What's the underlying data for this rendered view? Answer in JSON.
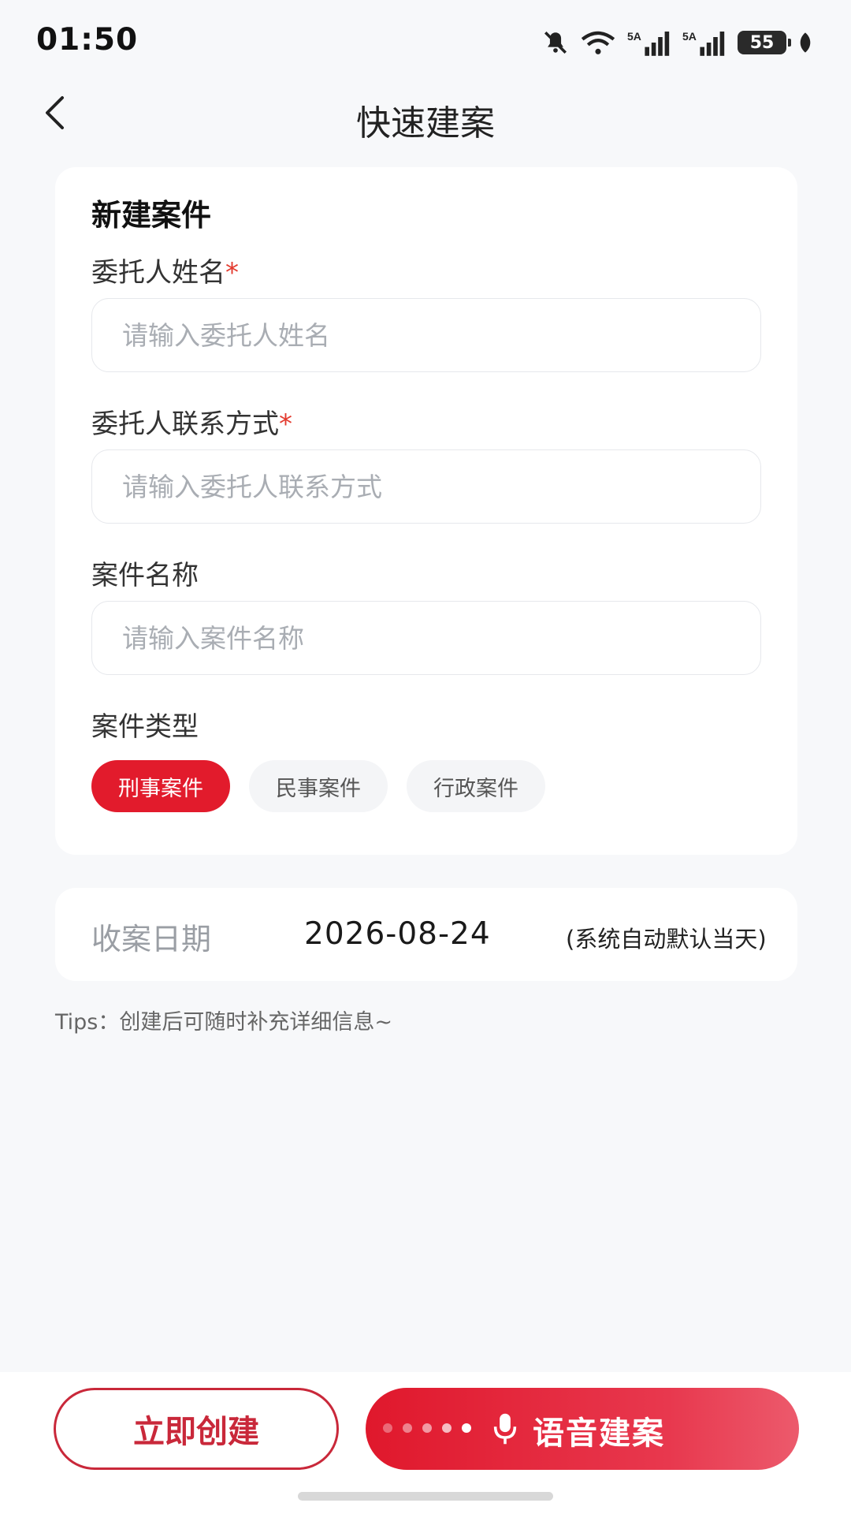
{
  "status_bar": {
    "time": "01:50",
    "battery": "55",
    "icons": [
      "bell-muted-icon",
      "wifi-icon",
      "signal-5a-icon",
      "signal-5a-icon",
      "battery-icon",
      "leaf-icon"
    ]
  },
  "nav": {
    "title": "快速建案",
    "back_icon": "chevron-left-icon"
  },
  "form": {
    "title": "新建案件",
    "fields": [
      {
        "label": "委托人姓名",
        "required_mark": "*",
        "placeholder": "请输入委托人姓名",
        "value": ""
      },
      {
        "label": "委托人联系方式",
        "required_mark": "*",
        "placeholder": "请输入委托人联系方式",
        "value": ""
      },
      {
        "label": "案件名称",
        "placeholder": "请输入案件名称",
        "value": ""
      }
    ],
    "case_type_label": "案件类型",
    "case_types": [
      "刑事案件",
      "民事案件",
      "行政案件"
    ],
    "selected_case_type": "刑事案件"
  },
  "date": {
    "label": "收案日期",
    "value": "2026-08-24",
    "note": "(系统自动默认当天)"
  },
  "tips": "Tips：创建后可随时补充详细信息~",
  "actions": {
    "create": "立即创建",
    "voice": "语音建案",
    "voice_icon": "microphone-icon"
  },
  "colors": {
    "accent": "#E21B2C",
    "required": "#E33A2E",
    "background": "#F7F8FA"
  }
}
